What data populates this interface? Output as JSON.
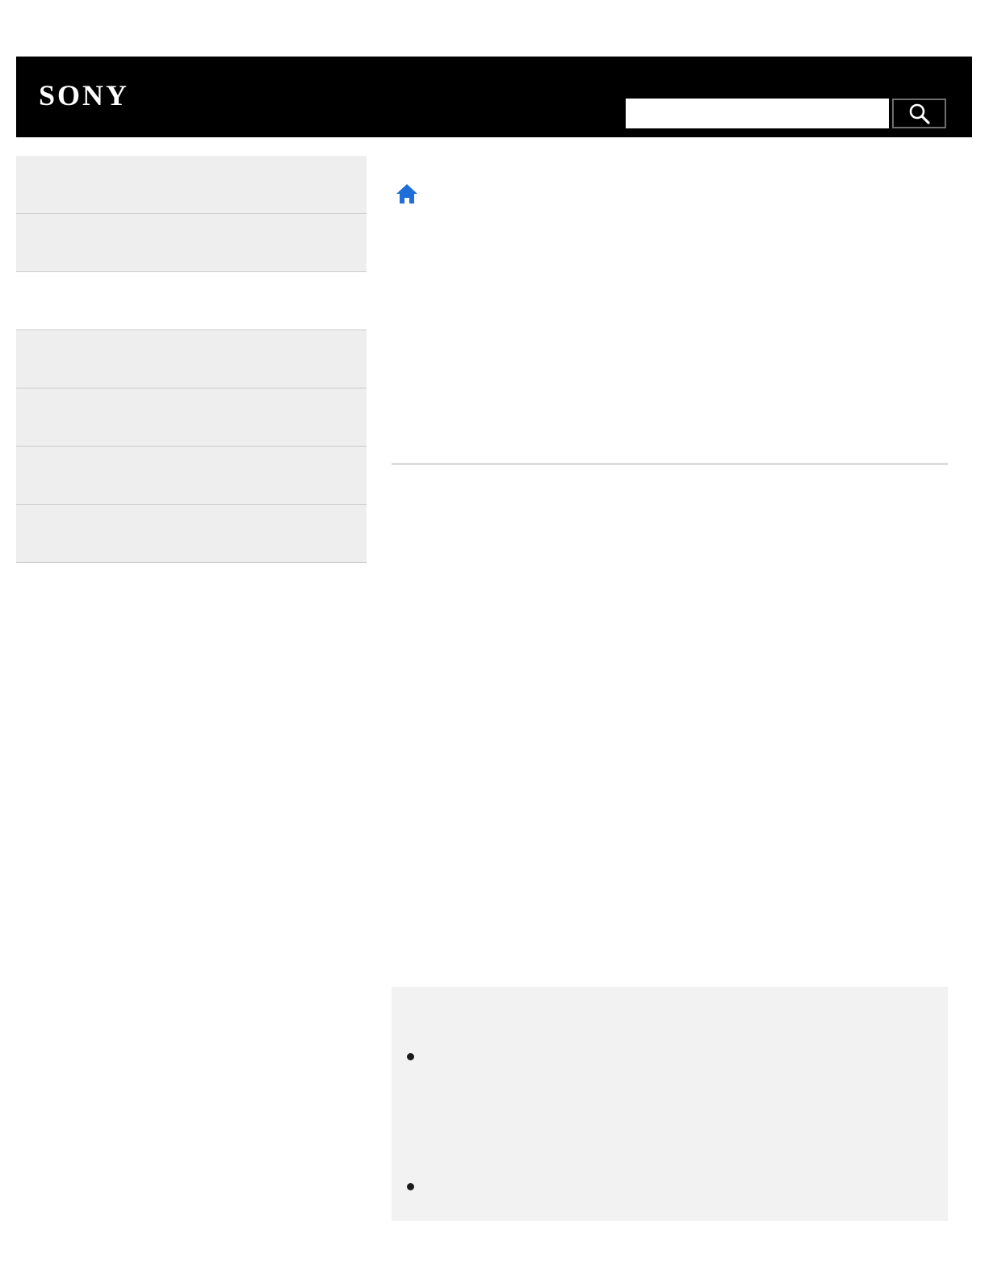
{
  "header": {
    "logo_text": "SONY",
    "background_color": "#000000"
  },
  "search": {
    "placeholder": "",
    "value": "",
    "button_icon": "magnifier-icon"
  },
  "sidebar": {
    "items": [
      {
        "label": ""
      },
      {
        "label": ""
      },
      {
        "label": ""
      },
      {
        "label": ""
      },
      {
        "label": ""
      },
      {
        "label": ""
      }
    ]
  },
  "breadcrumb": {
    "home_icon": "home-icon",
    "home_color": "#1e6fd9"
  },
  "note": {
    "items": [
      {
        "text": ""
      },
      {
        "text": ""
      }
    ]
  }
}
